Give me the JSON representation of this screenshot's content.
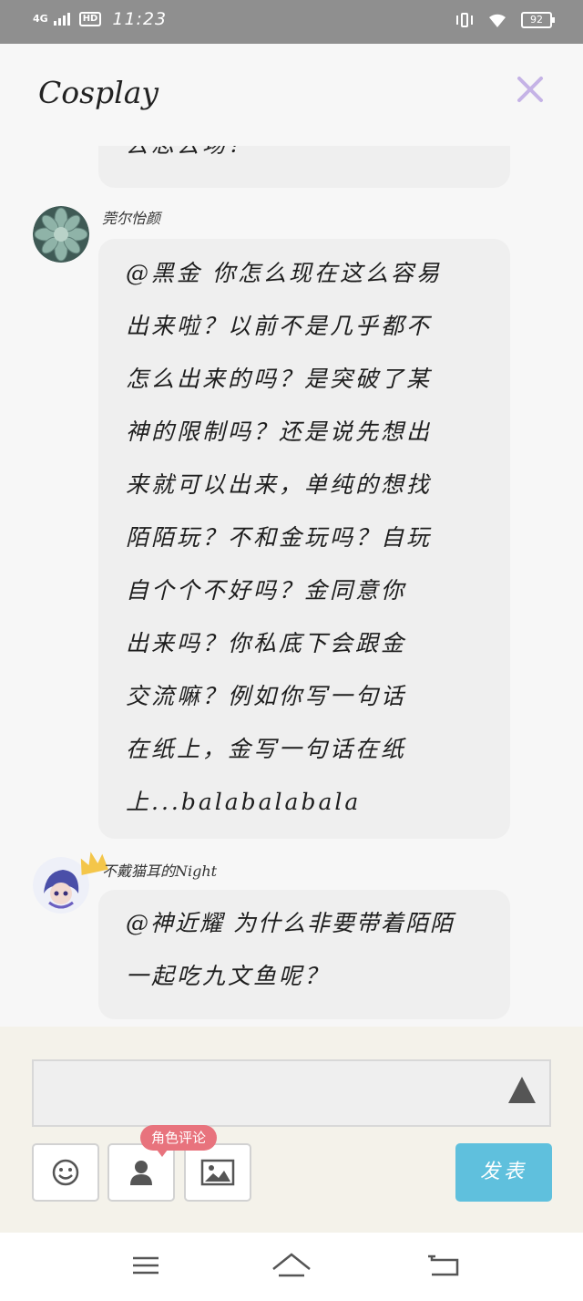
{
  "status_bar": {
    "network": "4G",
    "hd": "HD",
    "time": "11:23",
    "battery": "92"
  },
  "header": {
    "title": "Cosplay"
  },
  "messages": [
    {
      "lines": [
        "去思去场？"
      ]
    },
    {
      "author": "莞尔怡颜",
      "lines": [
        "@黑金 你怎么现在这么容易",
        "出来啦？以前不是几乎都不",
        "怎么出来的吗？是突破了某",
        "神的限制吗？还是说先想出",
        "来就可以出来，单纯的想找",
        "陌陌玩？不和金玩吗？自玩",
        "自个个不好吗？金同意你",
        "出来吗？你私底下会跟金",
        "交流嘛？例如你写一句话",
        "在纸上，金写一句话在纸",
        "上...balabalabala"
      ]
    },
    {
      "author": "不戴猫耳的Night",
      "lines": [
        "@神近耀 为什么非要带着陌陌",
        "一起吃九文鱼呢？"
      ]
    }
  ],
  "composer": {
    "role_comment_badge": "角色评论",
    "publish_label": "发表"
  },
  "colors": {
    "accent_close": "#c5b3e6",
    "publish": "#5fc0dd",
    "badge": "#e8737d"
  }
}
